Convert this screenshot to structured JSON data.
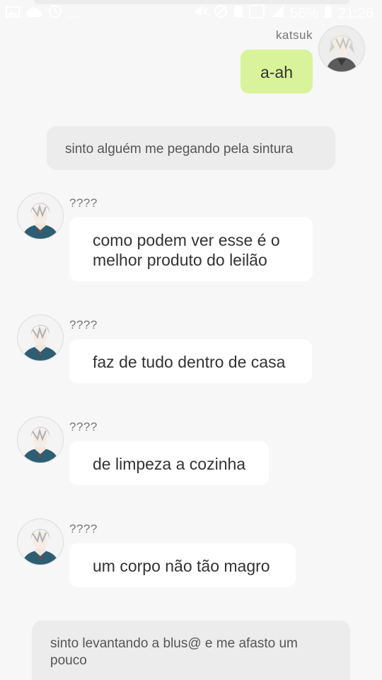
{
  "status_bar": {
    "icons_left": [
      "picture-icon",
      "cloud-icon",
      "clock-icon",
      "more-icon"
    ],
    "more_label": "...",
    "battery": "56%",
    "time": "21:26"
  },
  "messages": [
    {
      "type": "outgoing",
      "sender": "katsuk",
      "text": "a-ah",
      "bubble_color": "#d8f39a"
    },
    {
      "type": "narration",
      "text": "sinto alguém me pegando pela sintura"
    },
    {
      "type": "incoming",
      "sender": "????",
      "text": "como podem ver esse é o melhor produto do leilão"
    },
    {
      "type": "incoming",
      "sender": "????",
      "text": "faz de tudo dentro de casa"
    },
    {
      "type": "incoming",
      "sender": "????",
      "text": "de limpeza a cozinha"
    },
    {
      "type": "incoming",
      "sender": "????",
      "text": "um corpo não tão magro"
    },
    {
      "type": "narration",
      "text": "sinto levantando a blus@ e me afasto um pouco"
    }
  ]
}
